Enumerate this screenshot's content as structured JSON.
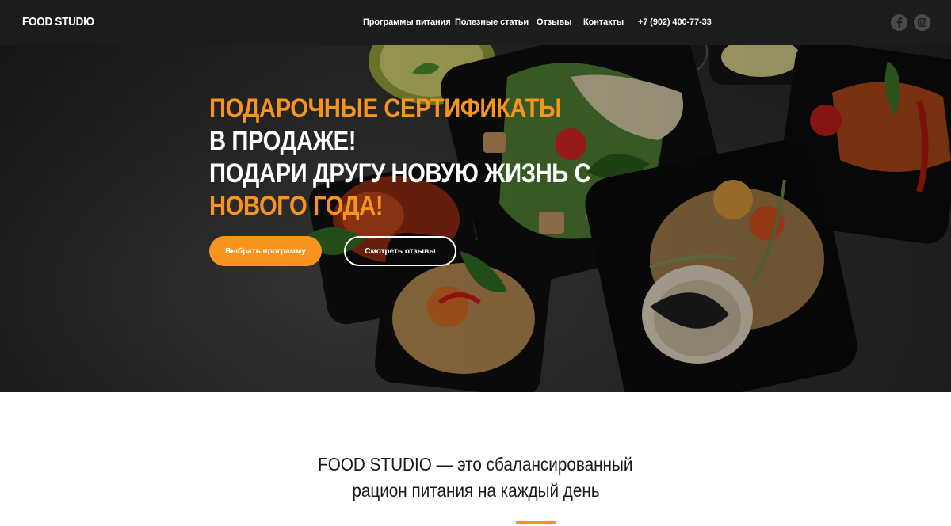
{
  "header": {
    "logo": "FOOD STUDIO",
    "nav": [
      {
        "label": "Программы питания"
      },
      {
        "label": "Полезные статьи"
      },
      {
        "label": "Отзывы"
      },
      {
        "label": "Контакты"
      },
      {
        "label": "+7 (902) 400-77-33"
      }
    ],
    "social": [
      {
        "icon": "facebook-icon"
      },
      {
        "icon": "instagram-icon"
      }
    ]
  },
  "hero": {
    "headline": [
      "ПОДАРОЧНЫЕ СЕРТИФИКАТЫ",
      "В ПРОДАЖЕ!",
      "ПОДАРИ ДРУГУ НОВУЮ ЖИЗНЬ С",
      "НОВОГО ГОДА!"
    ],
    "primary_button": "Выбрать программу",
    "secondary_button": "Смотреть отзывы",
    "background_image": "food-containers-photo"
  },
  "about": {
    "line1": "FOOD STUDIO — это сбалансированный",
    "line2": "рацион питания на каждый день"
  },
  "colors": {
    "accent": "#f7941d",
    "header_bg": "#1c1c1c",
    "text_dark": "#1a1a1a"
  }
}
